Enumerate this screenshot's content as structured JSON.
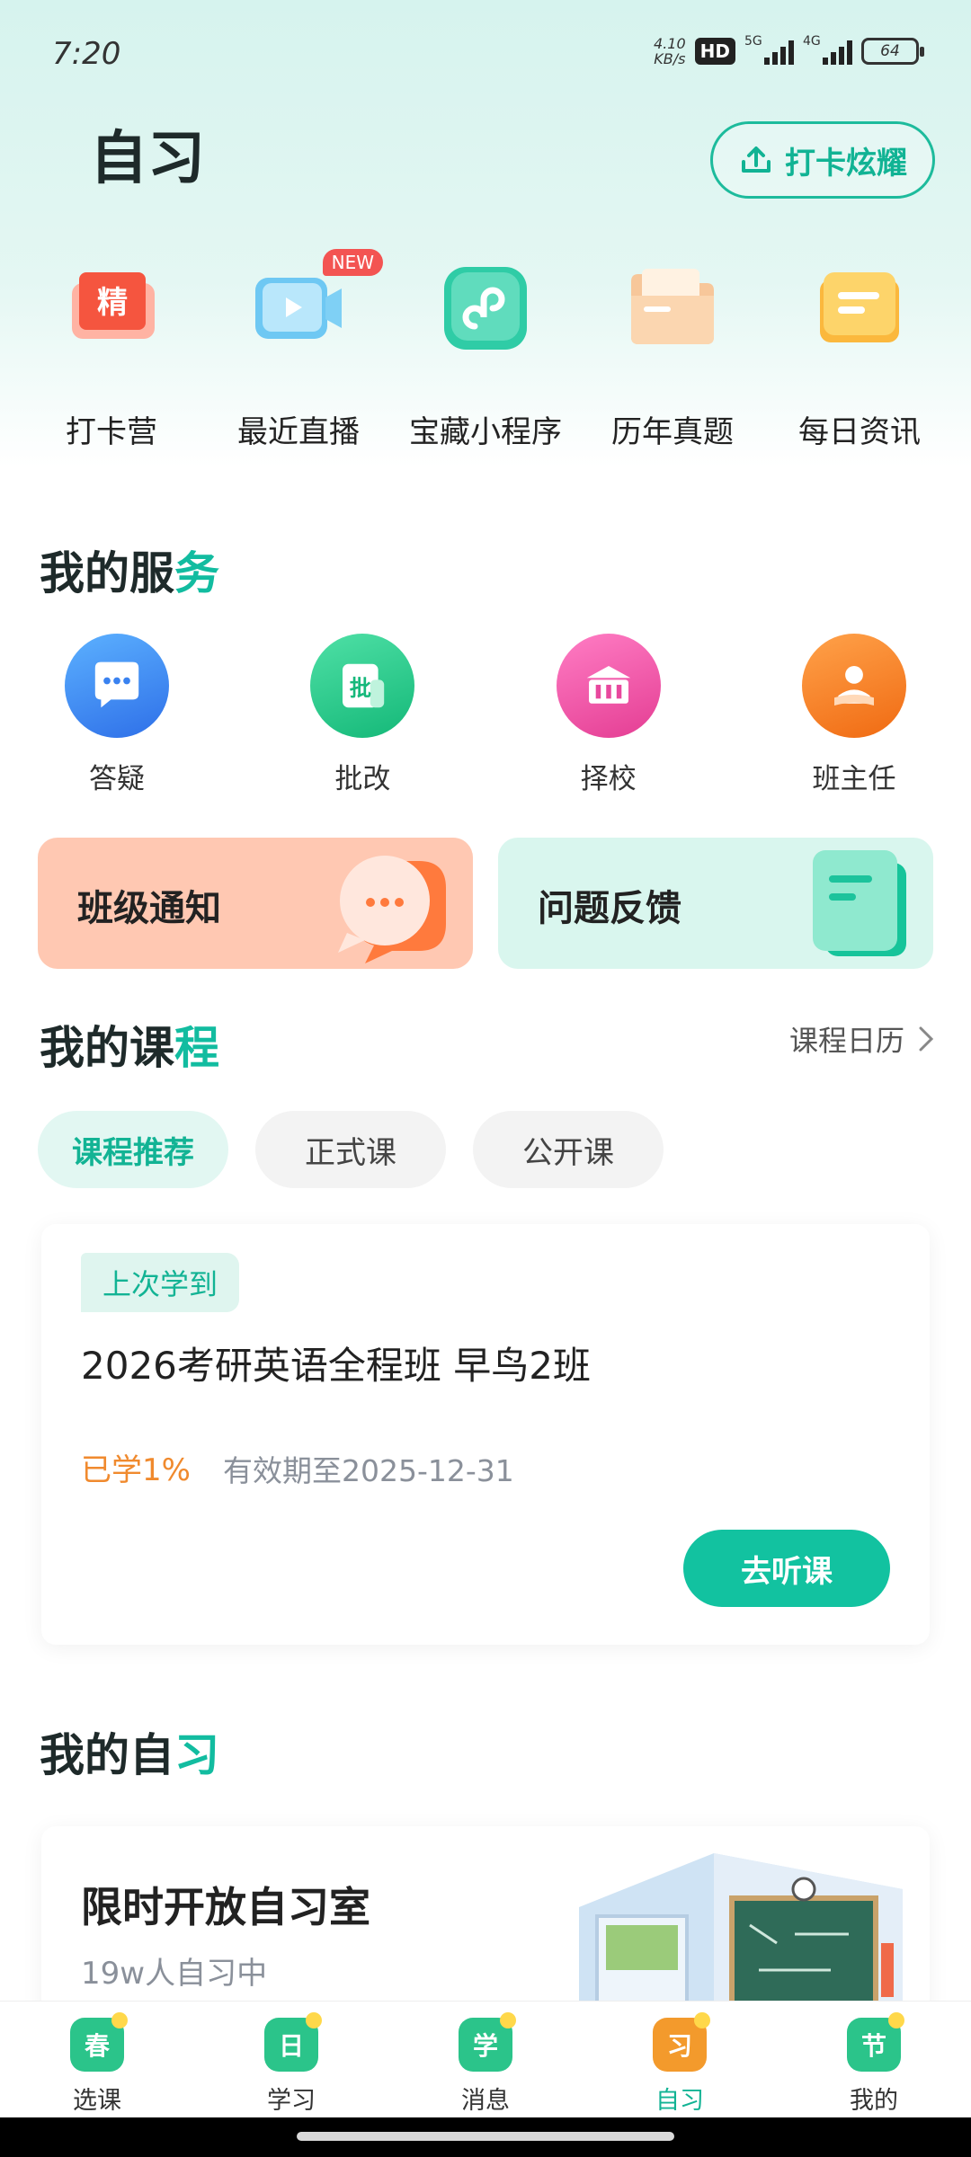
{
  "status_bar": {
    "time": "7:20",
    "net_speed_value": "4.10",
    "net_speed_unit": "KB/s",
    "hd": "HD",
    "sim1": "5G",
    "sim2": "4G",
    "battery": "64"
  },
  "header": {
    "title": "自习",
    "checkin_button": "打卡炫耀"
  },
  "quick_entries": [
    {
      "label": "打卡营",
      "icon": "camp-badge-icon",
      "icon_text": "精"
    },
    {
      "label": "最近直播",
      "icon": "live-video-icon",
      "badge": "NEW"
    },
    {
      "label": "宝藏小程序",
      "icon": "mini-program-icon"
    },
    {
      "label": "历年真题",
      "icon": "folder-icon"
    },
    {
      "label": "每日资讯",
      "icon": "news-card-icon"
    }
  ],
  "services": {
    "title_main": "我的服",
    "title_hl": "务",
    "items": [
      {
        "label": "答疑",
        "icon": "chat-bubble-icon",
        "color": "#3f8cf4"
      },
      {
        "label": "批改",
        "icon": "correct-doc-icon",
        "icon_text": "批",
        "color": "#22c98d"
      },
      {
        "label": "择校",
        "icon": "school-building-icon",
        "color": "#f055a8"
      },
      {
        "label": "班主任",
        "icon": "teacher-icon",
        "color": "#f78122"
      }
    ],
    "notice_card": "班级通知",
    "feedback_card": "问题反馈"
  },
  "courses": {
    "title_main": "我的课",
    "title_hl": "程",
    "calendar_link": "课程日历",
    "chips": [
      "课程推荐",
      "正式课",
      "公开课"
    ],
    "card": {
      "tag": "上次学到",
      "title": "2026考研英语全程班 早鸟2班",
      "progress": "已学1%",
      "valid": "有效期至2025-12-31",
      "button": "去听课"
    }
  },
  "self_study": {
    "title_main": "我的自",
    "title_hl": "习",
    "card_title": "限时开放自习室",
    "card_sub": "19w人自习中"
  },
  "tab_bar": [
    {
      "label": "选课",
      "icon_text": "春",
      "color": "#2bc48a"
    },
    {
      "label": "学习",
      "icon_text": "日",
      "color": "#2bc48a"
    },
    {
      "label": "消息",
      "icon_text": "学",
      "color": "#2bc48a"
    },
    {
      "label": "自习",
      "icon_text": "习",
      "color": "#f39a2c",
      "active": true
    },
    {
      "label": "我的",
      "icon_text": "节",
      "color": "#2bc48a"
    }
  ],
  "colors": {
    "accent": "#12bca0",
    "progress_orange": "#f08a2e"
  }
}
